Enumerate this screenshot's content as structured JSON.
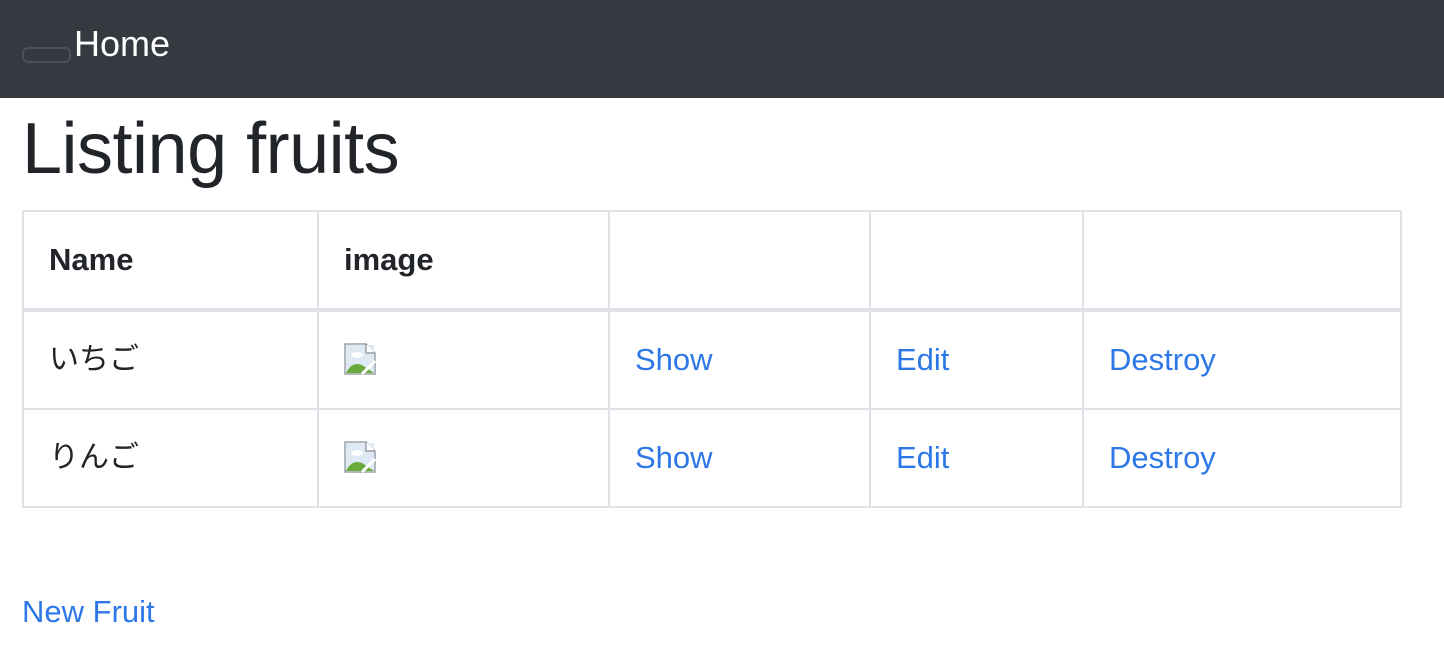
{
  "navbar": {
    "home_label": "Home"
  },
  "page": {
    "title": "Listing fruits"
  },
  "table": {
    "headers": [
      "Name",
      "image",
      "",
      "",
      ""
    ],
    "rows": [
      {
        "name": "いちご",
        "show": "Show",
        "edit": "Edit",
        "destroy": "Destroy"
      },
      {
        "name": "りんご",
        "show": "Show",
        "edit": "Edit",
        "destroy": "Destroy"
      }
    ]
  },
  "actions": {
    "new_label": "New Fruit"
  },
  "colors": {
    "navbar_bg": "#343a40",
    "link": "#2d78e6",
    "border": "#dee2e6"
  }
}
